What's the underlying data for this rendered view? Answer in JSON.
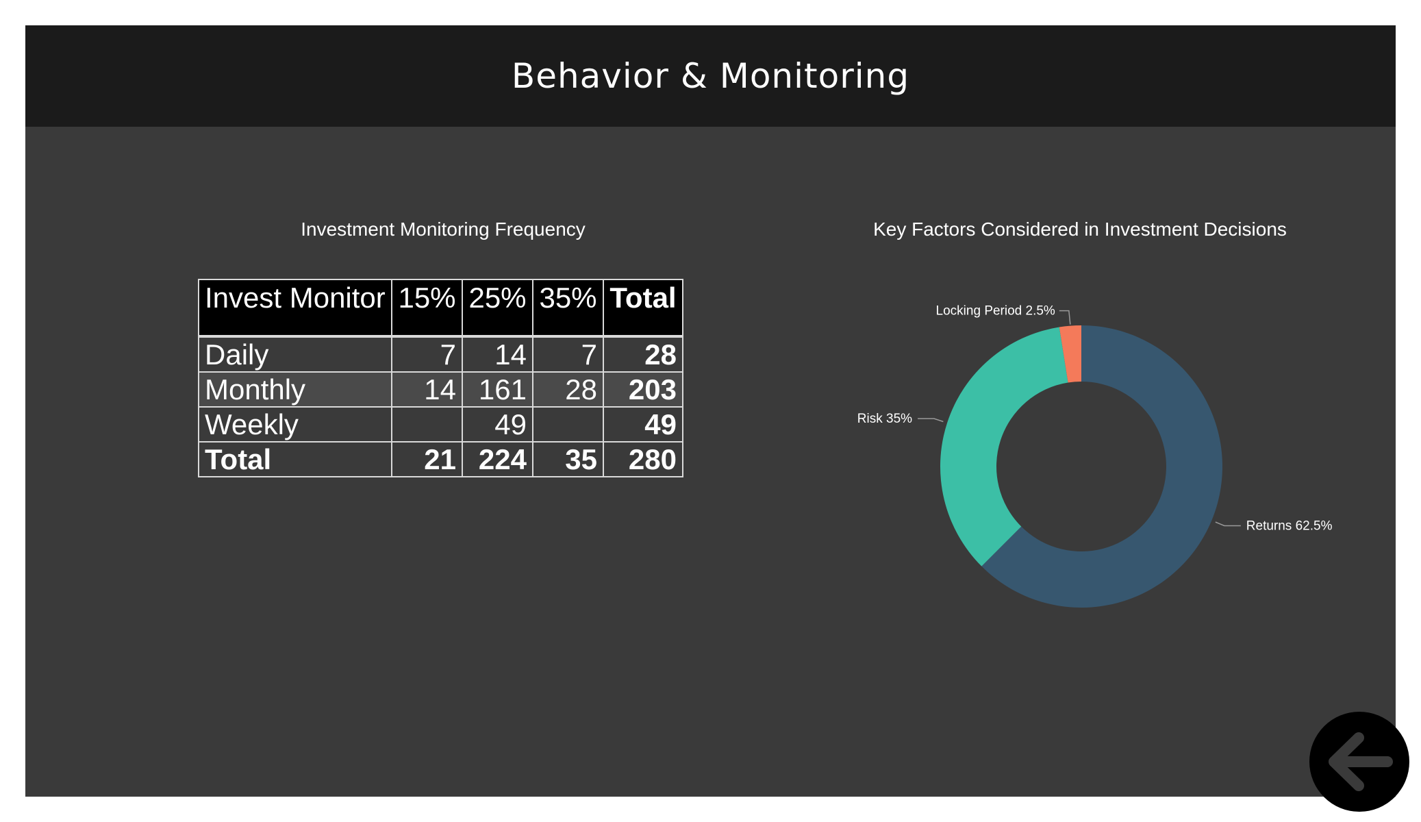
{
  "header": {
    "title": "Behavior & Monitoring"
  },
  "table": {
    "title": "Investment Monitoring Frequency",
    "columns": [
      "Invest Monitor",
      "15%",
      "25%",
      "35%",
      "Total"
    ],
    "rows": [
      [
        "Daily",
        "7",
        "14",
        "7",
        "28"
      ],
      [
        "Monthly",
        "14",
        "161",
        "28",
        "203"
      ],
      [
        "Weekly",
        "",
        "49",
        "",
        "49"
      ],
      [
        "Total",
        "21",
        "224",
        "35",
        "280"
      ]
    ]
  },
  "chart_data": {
    "type": "pie",
    "title": "Key Factors Considered in Investment Decisions",
    "donut": true,
    "slices": [
      {
        "label": "Returns",
        "value": 62.5,
        "label_text": "Returns 62.5%",
        "color": "#37576f"
      },
      {
        "label": "Risk",
        "value": 35,
        "label_text": "Risk 35%",
        "color": "#3cbfa6"
      },
      {
        "label": "Locking Period",
        "value": 2.5,
        "label_text": "Locking Period 2.5%",
        "color": "#f47a5a"
      }
    ]
  },
  "colors": {
    "background": "#3a3a3a",
    "header": "#1b1b1b",
    "table_header": "#000000",
    "table_alt_row": "#4a4a4a"
  },
  "back_button": {
    "icon": "arrow-left-icon"
  }
}
